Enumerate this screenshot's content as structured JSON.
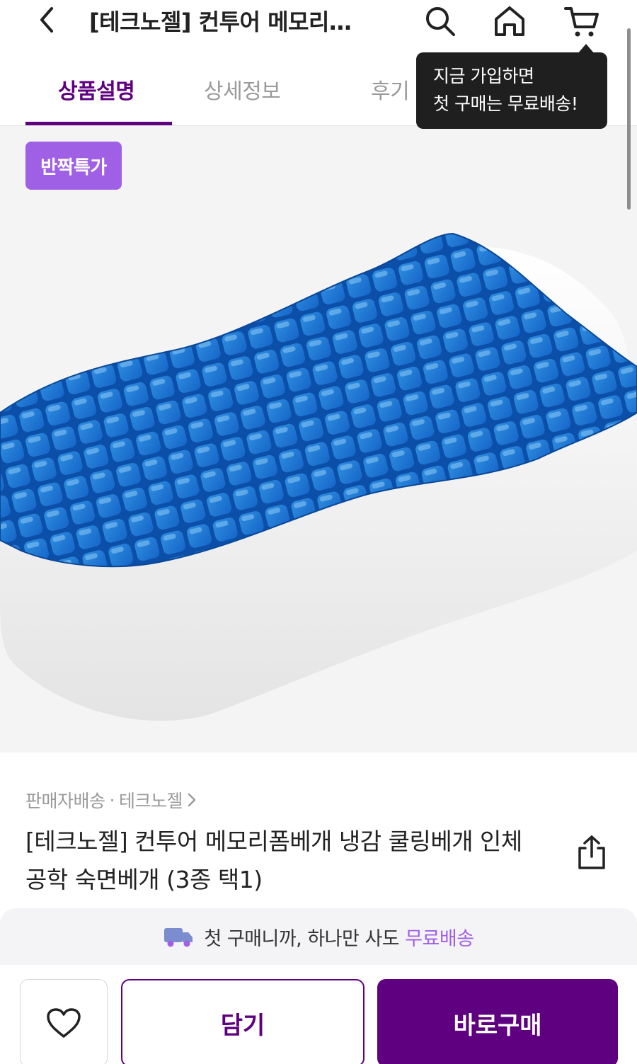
{
  "header": {
    "title": "[테크노젤] 컨투어 메모리…",
    "back_icon": "chevron-left-icon",
    "search_icon": "search-icon",
    "home_icon": "home-icon",
    "cart_icon": "cart-icon"
  },
  "tabs": [
    {
      "label": "상품설명",
      "active": true
    },
    {
      "label": "상세정보",
      "active": false
    },
    {
      "label": "후기",
      "active": false
    }
  ],
  "tooltip": {
    "line1": "지금 가입하면",
    "line2": "첫 구매는 무료배송!"
  },
  "image": {
    "badge": "반짝특가"
  },
  "product": {
    "seller_type": "판매자배송",
    "separator": "·",
    "brand": "테크노젤",
    "name": "[테크노젤] 컨투어 메모리폼베개 냉감 쿨링베개 인체공학 숙면베개 (3종 택1)"
  },
  "promo": {
    "text": "첫 구매니까, 하나만 사도",
    "accent": "무료배송"
  },
  "actions": {
    "add_to_cart": "담기",
    "buy_now": "바로구매"
  },
  "colors": {
    "brand_purple": "#5f0080",
    "accent_lavender": "#a060e6",
    "tooltip_bg": "#1f1f1f"
  }
}
